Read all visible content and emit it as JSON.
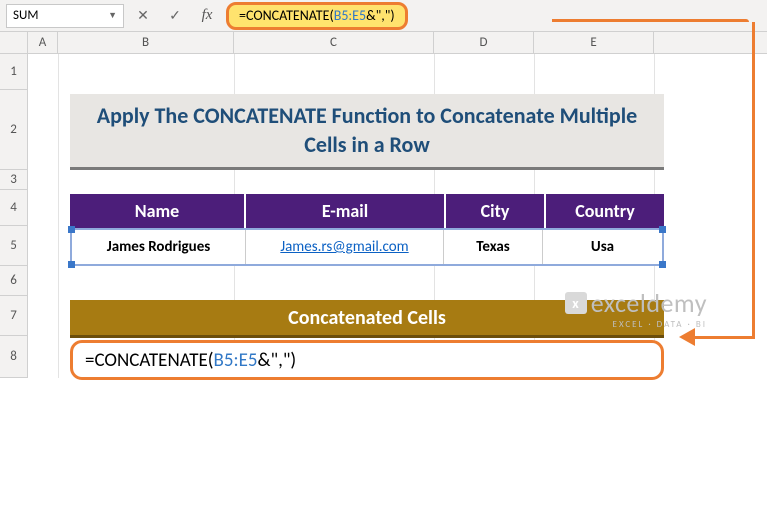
{
  "name_box": "SUM",
  "formula_bar": {
    "prefix": "=CONCATENATE(",
    "ref": "B5:E5",
    "suffix": "&\",\")"
  },
  "columns": [
    "A",
    "B",
    "C",
    "D",
    "E"
  ],
  "rows": [
    "1",
    "2",
    "3",
    "4",
    "5",
    "6",
    "7",
    "8"
  ],
  "title": "Apply The CONCATENATE Function to Concatenate Multiple Cells in a Row",
  "headers": {
    "b": "Name",
    "c": "E-mail",
    "d": "City",
    "e": "Country"
  },
  "data_row": {
    "b": "James Rodrigues",
    "c": "James.rs@gmail.com",
    "d": "Texas",
    "e": "Usa"
  },
  "concat_header": "Concatenated Cells",
  "cell_formula": {
    "prefix": "=CONCATENATE(",
    "ref": "B5:E5",
    "suffix": "&\",\")"
  },
  "watermark": {
    "brand": "exceldemy",
    "sub": "EXCEL · DATA · BI"
  }
}
